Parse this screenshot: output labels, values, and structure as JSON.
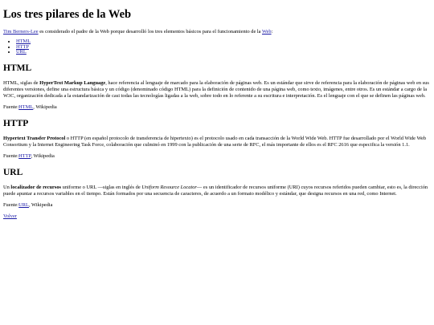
{
  "title": "Los tres pilares de la Web",
  "intro": {
    "link_person": "Tim Berners-Lee",
    "text_before_web": " es considerado el padre de la Web porque desarrolló los tres elementos básicos para el funcionamiento de la ",
    "link_web": "Web",
    "text_after_web": ":"
  },
  "nav_list": [
    "HTML",
    "HTTP",
    "URL"
  ],
  "sections": {
    "html": {
      "heading": "HTML",
      "text_1": "HTML, siglas de ",
      "bold": "HyperText Markup Language",
      "text_2": ", hace referencia al lenguaje de marcado para la elaboración de páginas web. Es un estándar que sirve de referencia para la elaboración de páginas web en sus diferentes versiones, define una estructura básica y un código (denominado código HTML) para la definición de contenido de una página web, como texto, imágenes, entre otros. Es un estándar a cargo de la W3C, organización dedicada a la estandarización de casi todas las tecnologías ligadas a la web, sobre todo en lo referente a su escritura e interpretación. Es el lenguaje con el que se definen las páginas web.",
      "source_label": "Fuente:",
      "source_link": "HTML",
      "source_suffix": ", Wikipedia"
    },
    "http": {
      "heading": "HTTP",
      "bold": "Hypertext Transfer Protocol",
      "text_2": " o HTTP (en español protocolo de transferencia de hipertexto) es el protocolo usado en cada transacción de la World Wide Web. HTTP fue desarrollado por el World Wide Web Consortium y la Internet Engineering Task Force, colaboración que culminó en 1999 con la publicación de una serie de RFC, el más importante de ellos es el RFC 2616 que especifica la versión 1.1.",
      "source_label": "Fuente:",
      "source_link": "HTTP",
      "source_suffix": ", Wikipedia"
    },
    "url": {
      "heading": "URL",
      "text_1": "Un ",
      "bold": "localizador de recursos",
      "text_2": " uniforme o URL —siglas en inglés de ",
      "italic": "Uniform Resource Locator",
      "text_3": "— es un identificador de recursos uniforme (URI) cuyos recursos referidos pueden cambiar, esto es, la dirección puede apuntar a recursos variables en el tiempo. Están formados por una secuencia de caracteres, de acuerdo a un formato modélico y estándar, que designa recursos en una red, como Internet.",
      "source_label": "Fuente:",
      "source_link": "URL",
      "source_suffix": ", Wikipedia"
    }
  },
  "back_link": "Volver",
  "colors": {
    "link": "#1a1aa6",
    "text": "#000000",
    "background": "#ffffff"
  }
}
